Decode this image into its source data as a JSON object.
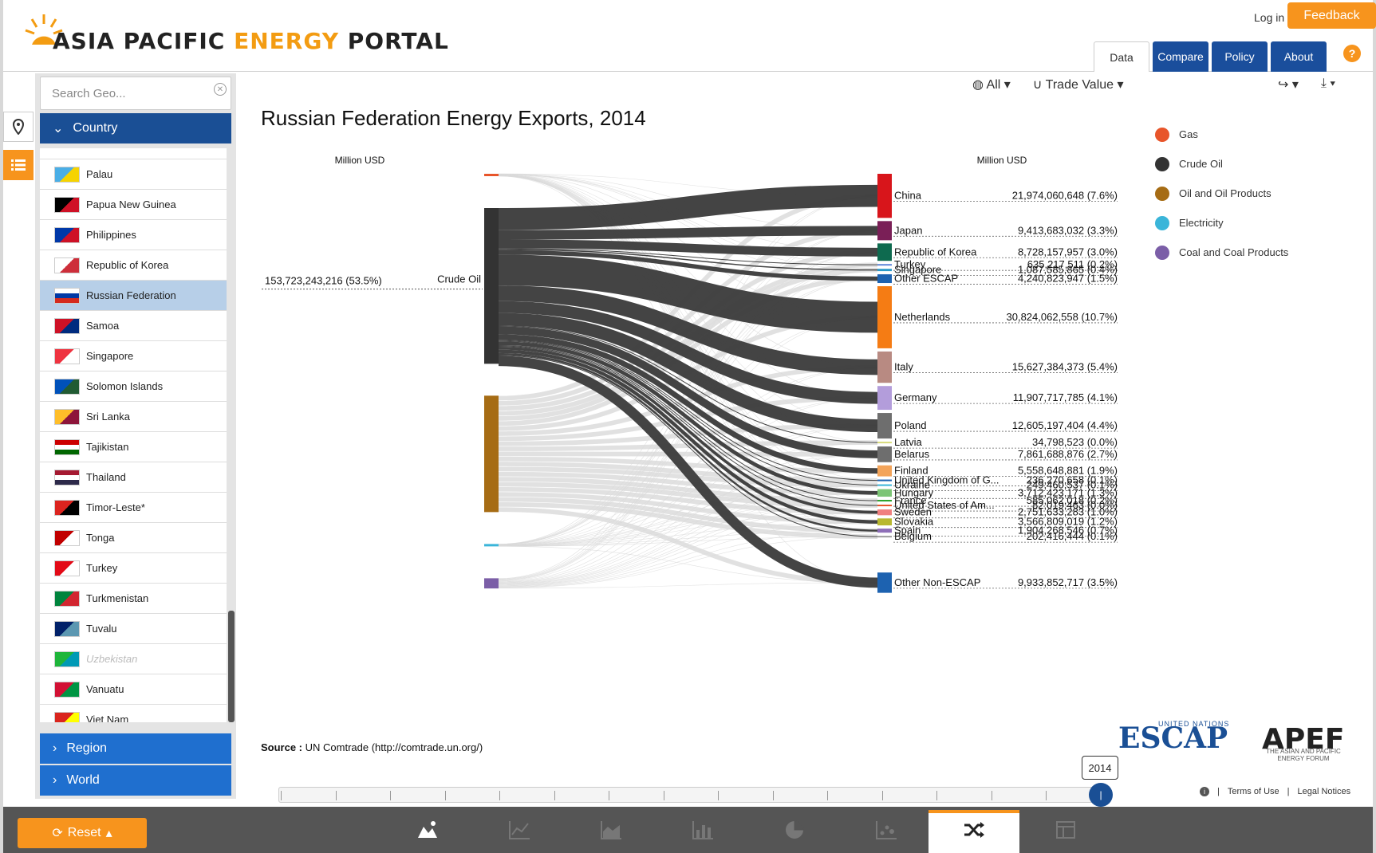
{
  "header": {
    "logo_text_1": "ASIA PACIFIC ",
    "logo_text_2": "ENERGY",
    "logo_text_3": " PORTAL",
    "login": "Log in",
    "feedback": "Feedback",
    "tabs": [
      "Data",
      "Compare",
      "Policy",
      "About"
    ],
    "help": "?"
  },
  "sidebar": {
    "search_placeholder": "Search Geo...",
    "country_label": "Country",
    "region_label": "Region",
    "world_label": "World",
    "items": [
      {
        "label": "Palau",
        "flag": [
          "#4aaee6",
          "#f6d300"
        ],
        "state": "normal"
      },
      {
        "label": "Papua New Guinea",
        "flag": [
          "#000000",
          "#cf1126"
        ],
        "state": "normal"
      },
      {
        "label": "Philippines",
        "flag": [
          "#0038a8",
          "#ce1126"
        ],
        "state": "normal"
      },
      {
        "label": "Republic of Korea",
        "flag": [
          "#ffffff",
          "#cd2e3a"
        ],
        "state": "normal"
      },
      {
        "label": "Russian Federation",
        "flag": [
          "#ffffff",
          "#0039a6",
          "#d52b1e"
        ],
        "state": "selected"
      },
      {
        "label": "Samoa",
        "flag": [
          "#ce1126",
          "#002b7f"
        ],
        "state": "normal"
      },
      {
        "label": "Singapore",
        "flag": [
          "#ef3340",
          "#ffffff"
        ],
        "state": "normal"
      },
      {
        "label": "Solomon Islands",
        "flag": [
          "#0051ba",
          "#215b33"
        ],
        "state": "normal"
      },
      {
        "label": "Sri Lanka",
        "flag": [
          "#ffbe29",
          "#8d153a"
        ],
        "state": "normal"
      },
      {
        "label": "Tajikistan",
        "flag": [
          "#cc0000",
          "#ffffff",
          "#006600"
        ],
        "state": "normal"
      },
      {
        "label": "Thailand",
        "flag": [
          "#a51931",
          "#ffffff",
          "#2d2a4a"
        ],
        "state": "normal"
      },
      {
        "label": "Timor-Leste*",
        "flag": [
          "#dc241f",
          "#000000"
        ],
        "state": "normal"
      },
      {
        "label": "Tonga",
        "flag": [
          "#c10000",
          "#ffffff"
        ],
        "state": "normal"
      },
      {
        "label": "Turkey",
        "flag": [
          "#e30a17",
          "#ffffff"
        ],
        "state": "normal"
      },
      {
        "label": "Turkmenistan",
        "flag": [
          "#00843d",
          "#d22630"
        ],
        "state": "normal"
      },
      {
        "label": "Tuvalu",
        "flag": [
          "#012169",
          "#5b97b1"
        ],
        "state": "normal"
      },
      {
        "label": "Uzbekistan",
        "flag": [
          "#1eb53a",
          "#0099b5"
        ],
        "state": "disabled"
      },
      {
        "label": "Vanuatu",
        "flag": [
          "#d21034",
          "#009543"
        ],
        "state": "normal"
      },
      {
        "label": "Viet Nam",
        "flag": [
          "#da251d",
          "#ffff00"
        ],
        "state": "normal"
      }
    ]
  },
  "toolbar": {
    "all_label": "All",
    "trade_label": "Trade Value"
  },
  "chart_data": {
    "type": "sankey",
    "title": "Russian Federation Energy Exports, 2014",
    "left_axis_label": "Million USD",
    "right_axis_label": "Million USD",
    "left_nodes": [
      {
        "name": "Gas",
        "color": "#e8552a",
        "share": 0.5
      },
      {
        "name": "Crude Oil",
        "color": "#333333",
        "value_label": "153,723,243,216 (53.5%)",
        "share": 53.5
      },
      {
        "name": "Oil and Oil Products",
        "color": "#a66c14",
        "share": 40
      },
      {
        "name": "Electricity",
        "color": "#3ab5d9",
        "share": 0.2
      },
      {
        "name": "Coal and Coal Products",
        "color": "#7b5ea7",
        "share": 3.5
      }
    ],
    "destinations": [
      {
        "name": "China",
        "value": "21,974,060,648 (7.6%)",
        "pct": 7.6,
        "color": "#d8151b"
      },
      {
        "name": "Japan",
        "value": "9,413,683,032 (3.3%)",
        "pct": 3.3,
        "color": "#7a1f57"
      },
      {
        "name": "Republic of Korea",
        "value": "8,728,157,957 (3.0%)",
        "pct": 3.0,
        "color": "#0e6a4f"
      },
      {
        "name": "Turkey",
        "value": "635,217,511 (0.2%)",
        "pct": 0.2,
        "color": "#5f86d9"
      },
      {
        "name": "Singapore",
        "value": "1,087,585,865 (0.4%)",
        "pct": 0.4,
        "color": "#2b9ac9"
      },
      {
        "name": "Other ESCAP",
        "value": "4,240,823,947 (1.5%)",
        "pct": 1.5,
        "color": "#1d62b0"
      },
      {
        "name": "Netherlands",
        "value": "30,824,062,558 (10.7%)",
        "pct": 10.7,
        "color": "#f57c14"
      },
      {
        "name": "Italy",
        "value": "15,627,384,373 (5.4%)",
        "pct": 5.4,
        "color": "#b88a82"
      },
      {
        "name": "Germany",
        "value": "11,907,717,785 (4.1%)",
        "pct": 4.1,
        "color": "#b39ddb"
      },
      {
        "name": "Poland",
        "value": "12,605,197,404 (4.4%)",
        "pct": 4.4,
        "color": "#6e6e6e"
      },
      {
        "name": "Latvia",
        "value": "34,798,523 (0.0%)",
        "pct": 0.0,
        "color": "#d8dc7c"
      },
      {
        "name": "Belarus",
        "value": "7,861,688,876 (2.7%)",
        "pct": 2.7,
        "color": "#6e6e6e"
      },
      {
        "name": "Finland",
        "value": "5,558,648,881 (1.9%)",
        "pct": 1.9,
        "color": "#f3a45a"
      },
      {
        "name": "United Kingdom of G...",
        "value": "236,270,658 (0.1%)",
        "pct": 0.1,
        "color": "#1d62b0"
      },
      {
        "name": "Ukraine",
        "value": "249,460,537 (0.1%)",
        "pct": 0.1,
        "color": "#3ab5d9"
      },
      {
        "name": "Hungary",
        "value": "3,712,423,171 (1.3%)",
        "pct": 1.3,
        "color": "#7cc576"
      },
      {
        "name": "France",
        "value": "585,062,018 (0.2%)",
        "pct": 0.2,
        "color": "#2aa02a"
      },
      {
        "name": "United States of Am...",
        "value": "82,019,463 (0.0%)",
        "pct": 0.0,
        "color": "#e8552a"
      },
      {
        "name": "Sweden",
        "value": "2,751,633,283 (1.0%)",
        "pct": 1.0,
        "color": "#f08080"
      },
      {
        "name": "Slovakia",
        "value": "3,566,809,019 (1.2%)",
        "pct": 1.2,
        "color": "#b8b830"
      },
      {
        "name": "Spain",
        "value": "1,904,268,546 (0.7%)",
        "pct": 0.7,
        "color": "#8e6fb8"
      },
      {
        "name": "Belgium",
        "value": "202,416,444 (0.1%)",
        "pct": 0.1,
        "color": "#9e9e9e"
      },
      {
        "name": "Other Non-ESCAP",
        "value": "9,933,852,717 (3.5%)",
        "pct": 3.5,
        "color": "#1d62b0"
      }
    ]
  },
  "legend": [
    {
      "label": "Gas",
      "color": "#e8552a"
    },
    {
      "label": "Crude Oil",
      "color": "#333333"
    },
    {
      "label": "Oil and Oil Products",
      "color": "#a66c14"
    },
    {
      "label": "Electricity",
      "color": "#3ab5d9"
    },
    {
      "label": "Coal and Coal Products",
      "color": "#7b5ea7"
    }
  ],
  "source": {
    "label": "Source :",
    "text": "UN Comtrade (http://comtrade.un.org/)"
  },
  "timeline": {
    "year": "2014"
  },
  "logos": {
    "escap": "ESCAP",
    "escap_un": "UNITED NATIONS",
    "apef": "APEF",
    "apef_sub": "THE ASIAN AND PACIFIC ENERGY FORUM"
  },
  "footer": {
    "info": "i",
    "terms": "Terms of Use",
    "legal": "Legal Notices"
  },
  "bottombar": {
    "reset": "Reset"
  }
}
